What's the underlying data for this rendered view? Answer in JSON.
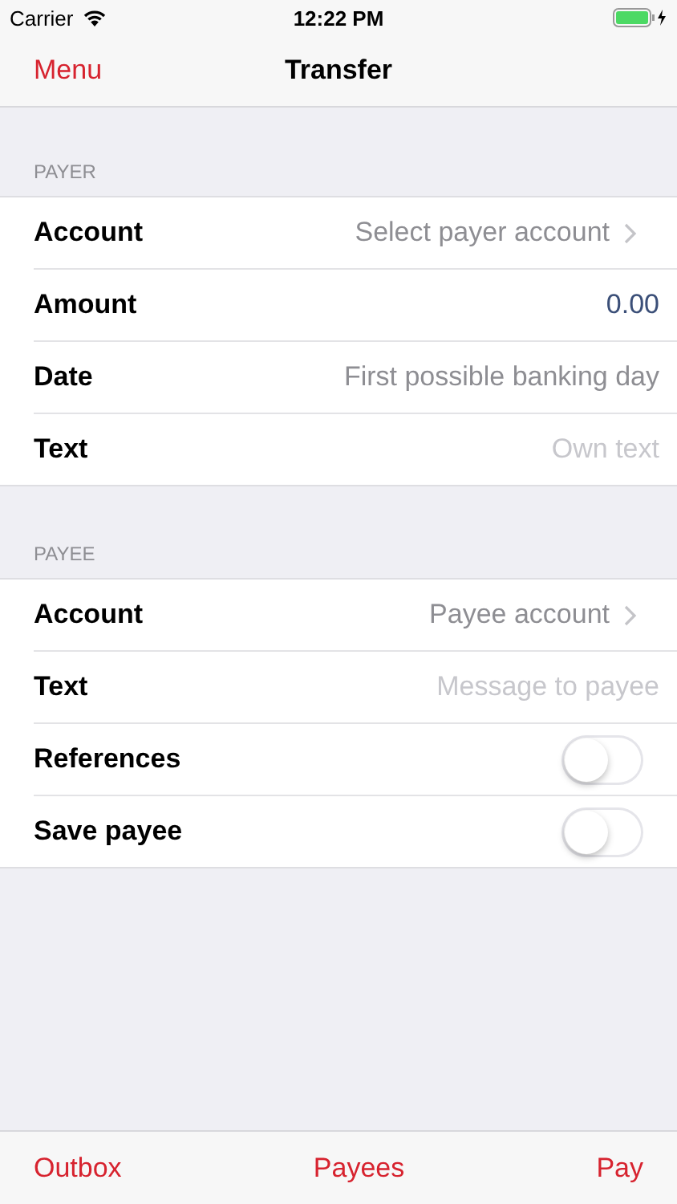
{
  "status_bar": {
    "carrier": "Carrier",
    "time": "12:22 PM"
  },
  "nav": {
    "left": "Menu",
    "title": "Transfer"
  },
  "sections": [
    {
      "header": "PAYER",
      "rows": [
        {
          "kind": "link",
          "label": "Account",
          "value": "Select payer account"
        },
        {
          "kind": "amount",
          "label": "Amount",
          "value": "0.00"
        },
        {
          "kind": "value",
          "label": "Date",
          "value": "First possible banking day"
        },
        {
          "kind": "input",
          "label": "Text",
          "placeholder": "Own text"
        }
      ]
    },
    {
      "header": "PAYEE",
      "rows": [
        {
          "kind": "link",
          "label": "Account",
          "value": "Payee account"
        },
        {
          "kind": "input",
          "label": "Text",
          "placeholder": "Message to payee"
        },
        {
          "kind": "toggle",
          "label": "References",
          "on": false
        },
        {
          "kind": "toggle",
          "label": "Save payee",
          "on": false
        }
      ]
    }
  ],
  "toolbar": [
    "Outbox",
    "Payees",
    "Pay"
  ]
}
